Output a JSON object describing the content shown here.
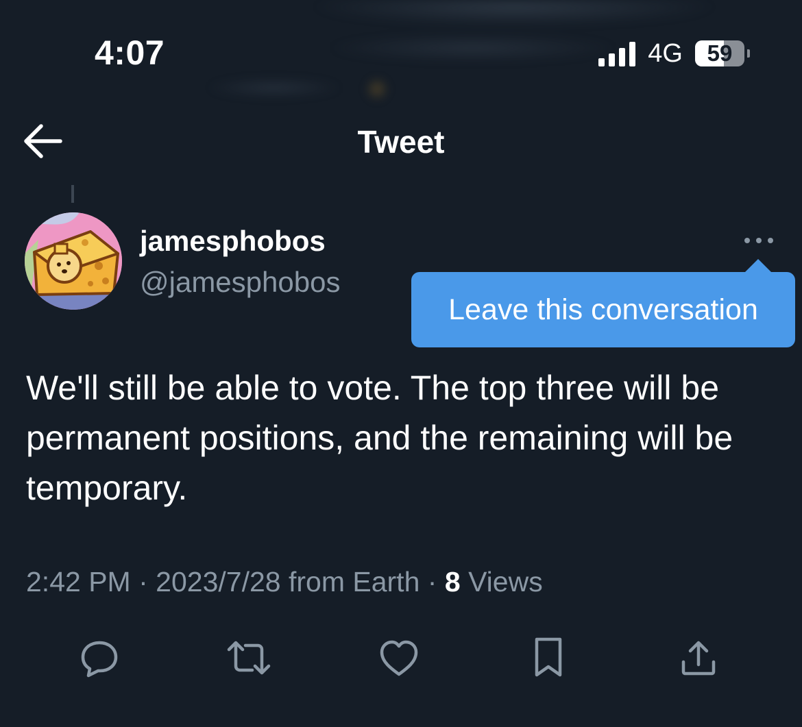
{
  "status_bar": {
    "time": "4:07",
    "network": "4G",
    "battery_percent": "59",
    "battery_level": 0.59
  },
  "header": {
    "title": "Tweet"
  },
  "tweet": {
    "display_name": "jamesphobos",
    "handle": "@jamesphobos",
    "text": "We'll still be able to vote. The top three will be permanent positions, and the remaining will be temporary.",
    "time": "2:42 PM",
    "date": "2023/7/28",
    "source": "from Earth",
    "separator": "·",
    "views_count": "8",
    "views_label": "Views"
  },
  "tooltip": {
    "label": "Leave this conversation"
  },
  "icons": {
    "back": "arrow-left-icon",
    "more": "more-horizontal-icon",
    "reply": "reply-icon",
    "retweet": "retweet-icon",
    "like": "heart-icon",
    "bookmark": "bookmark-icon",
    "share": "share-icon"
  },
  "colors": {
    "background": "#151d27",
    "tooltip": "#4a99e9",
    "secondary_text": "#8b98a5"
  }
}
